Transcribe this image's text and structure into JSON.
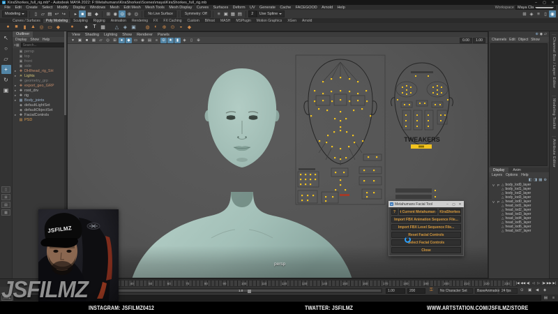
{
  "window": {
    "icon": "M",
    "title": "KiraShorkes_full_rig.mb* - Autodesk MAYA 2022: F:\\Metahumans\\KiraShorkes\\Scenes\\maya\\KiraShorkes_full_rig.mb",
    "min": "–",
    "max": "▢",
    "close": "✕"
  },
  "menubar": {
    "items": [
      "File",
      "Edit",
      "Create",
      "Select",
      "Modify",
      "Display",
      "Windows",
      "Mesh",
      "Edit Mesh",
      "Mesh Tools",
      "Mesh Display",
      "Curves",
      "Surfaces",
      "Deform",
      "UV",
      "Generate",
      "Cache",
      "FACEGOOD",
      "Arnold",
      "Help"
    ],
    "workspace_label": "Workspace",
    "workspace_value": "Maya Classic*"
  },
  "statusline": {
    "mode": "Modeling",
    "no_live_surface": "No Live Surface",
    "symmetry": "Symmetry: Off",
    "field": "2",
    "spline": "Use Spline",
    "group1": [
      {
        "n": "new-scene-icon",
        "g": "▯"
      },
      {
        "n": "open-scene-icon",
        "g": "▱"
      },
      {
        "n": "save-scene-icon",
        "g": "▤"
      },
      {
        "n": "undo-icon",
        "g": "↩"
      },
      {
        "n": "redo-icon",
        "g": "↪"
      }
    ],
    "group2": [
      {
        "n": "select-hierarchy-icon",
        "g": "▸"
      },
      {
        "n": "select-object-icon",
        "g": "■",
        "active": true
      },
      {
        "n": "select-component-icon",
        "g": "▦"
      },
      {
        "n": "select-mask-icon",
        "g": "◆"
      }
    ],
    "group3": [
      {
        "n": "snap-grid-icon",
        "g": "⊞"
      },
      {
        "n": "snap-curve-icon",
        "g": "◉"
      },
      {
        "n": "snap-point-icon",
        "g": "⊙",
        "active": true
      },
      {
        "n": "snap-plane-icon",
        "g": "⊕"
      },
      {
        "n": "make-live-icon",
        "g": "◎"
      }
    ],
    "group4": [
      {
        "n": "construction-history-icon",
        "g": "≡"
      },
      {
        "n": "render-view-icon",
        "g": "▣"
      },
      {
        "n": "render-current-frame-icon",
        "g": "▦"
      },
      {
        "n": "ipr-render-icon",
        "g": "▤"
      }
    ],
    "right_toggles": [
      {
        "n": "modeling-toolkit-toggle-icon",
        "g": "⊞"
      },
      {
        "n": "hypershade-toggle-icon",
        "g": "◈"
      },
      {
        "n": "outliner-toggle-icon",
        "g": "≡"
      },
      {
        "n": "panel-layout-icon",
        "g": "▯"
      },
      {
        "n": "tool-settings-toggle-icon",
        "g": "◉",
        "active": true
      }
    ]
  },
  "shelf": {
    "tabs": [
      {
        "label": "Curves / Surfaces"
      },
      {
        "label": "Poly Modeling",
        "active": true
      },
      {
        "label": "Sculpting"
      },
      {
        "label": "Rigging"
      },
      {
        "label": "Animation"
      },
      {
        "label": "Rendering"
      },
      {
        "label": "FX"
      },
      {
        "label": "FX Caching"
      },
      {
        "label": "Custom"
      },
      {
        "label": "Bifrost"
      },
      {
        "label": "MASH"
      },
      {
        "label": "MSPlugin"
      },
      {
        "label": "Motion Graphics"
      },
      {
        "label": "XGen"
      },
      {
        "label": "Arnold"
      }
    ],
    "icons": [
      {
        "n": "poly-sphere-icon",
        "g": "●",
        "c": "#d08a4a"
      },
      {
        "n": "poly-cube-icon",
        "g": "■",
        "c": "#d08a4a"
      },
      {
        "n": "poly-cylinder-icon",
        "g": "▮",
        "c": "#d08a4a"
      },
      {
        "n": "poly-cone-icon",
        "g": "▲",
        "c": "#d08a4a"
      },
      {
        "n": "poly-torus-icon",
        "g": "◎",
        "c": "#d08a4a"
      },
      {
        "n": "poly-plane-icon",
        "g": "▭",
        "c": "#d08a4a"
      },
      {
        "n": "poly-disc-icon",
        "g": "◆",
        "c": "#d08a4a"
      },
      {
        "n": "gap"
      },
      {
        "n": "platonic-solid-icon",
        "g": "●",
        "c": "#c87f42"
      },
      {
        "n": "gap"
      },
      {
        "n": "sweep-mesh-icon",
        "g": "★",
        "c": "#d8d8d8"
      },
      {
        "n": "type-tool-icon",
        "g": "T",
        "c": "#e0e0e0"
      },
      {
        "n": "svg-tool-icon",
        "g": "▦",
        "c": "#cfcfcf"
      },
      {
        "n": "gap"
      },
      {
        "n": "construction-plane-icon",
        "g": "△",
        "c": "#9db6c8"
      },
      {
        "n": "image-plane-icon",
        "g": "◈",
        "c": "#9db6c8"
      },
      {
        "n": "gpu-cache-icon",
        "g": "▣",
        "c": "#9db6c8"
      },
      {
        "n": "gap"
      },
      {
        "n": "boolean-union-icon",
        "g": "◍",
        "c": "#d08a4a"
      },
      {
        "n": "boolean-difference-icon",
        "g": "◐",
        "c": "#d08a4a"
      },
      {
        "n": "combine-icon",
        "g": "⊕",
        "c": "#d08a4a"
      },
      {
        "n": "separate-icon",
        "g": "⊙",
        "c": "#d08a4a"
      },
      {
        "n": "smooth-icon",
        "g": "◒",
        "c": "#d08a4a"
      },
      {
        "n": "bevel-icon",
        "g": "◆",
        "c": "#d08a4a"
      }
    ]
  },
  "toolbox": {
    "tools": [
      {
        "n": "select-tool-icon",
        "g": "↖"
      },
      {
        "n": "lasso-tool-icon",
        "g": "○"
      },
      {
        "n": "paint-select-tool-icon",
        "g": "▱"
      },
      {
        "n": "move-tool-icon",
        "g": "+",
        "active": true
      },
      {
        "n": "rotate-tool-icon",
        "g": "↻"
      },
      {
        "n": "scale-tool-icon",
        "g": "▣"
      }
    ],
    "layouts": [
      {
        "n": "layout-single-icon",
        "g": "▯"
      },
      {
        "n": "layout-four-icon",
        "g": "⊞"
      },
      {
        "n": "layout-split-icon",
        "g": "▤"
      },
      {
        "n": "layout-outliner-icon",
        "g": "▦"
      }
    ]
  },
  "outliner": {
    "tab": "Outliner",
    "menus": [
      "Display",
      "Show",
      "Help"
    ],
    "filter_icons": [
      {
        "n": "outliner-filter-icon",
        "g": "≡"
      },
      {
        "n": "outliner-sets-icon",
        "g": "▦"
      }
    ],
    "search_placeholder": "Search...",
    "items": [
      {
        "name": "persp",
        "icon": "▣",
        "c": "#8a8a8a",
        "dim": true
      },
      {
        "name": "top",
        "icon": "▣",
        "c": "#8a8a8a",
        "dim": true
      },
      {
        "name": "front",
        "icon": "▣",
        "c": "#8a8a8a",
        "dim": true
      },
      {
        "name": "side",
        "icon": "▣",
        "c": "#8a8a8a",
        "dim": true
      },
      {
        "name": "DHIhead_rig_SH",
        "exp": "▸",
        "icon": "✚",
        "c": "#c08a6a"
      },
      {
        "name": "Lights",
        "exp": "▸",
        "icon": "☀",
        "c": "#d8c878"
      },
      {
        "name": "geometry_grp",
        "icon": "✚",
        "c": "#8a8a8a",
        "dim": true
      },
      {
        "name": "export_geo_GRP",
        "exp": "▸",
        "icon": "✚",
        "c": "#c08a6a"
      },
      {
        "name": "root_drv",
        "exp": "▸",
        "icon": "✚",
        "c": "#b8b8b8"
      },
      {
        "name": "rig",
        "exp": "▸",
        "icon": "✚",
        "c": "#b8b8b8"
      },
      {
        "name": "Body_joints",
        "exp": "▸",
        "icon": "▦",
        "c": "#9ab0c8"
      },
      {
        "name": "defaultLightSet",
        "icon": "◈",
        "c": "#b0b0b0"
      },
      {
        "name": "defaultObjectSet",
        "icon": "◈",
        "c": "#b0b0b0"
      },
      {
        "name": "FacialControls",
        "exp": "▸",
        "icon": "✚",
        "c": "#b8b8b8"
      },
      {
        "name": "PSD",
        "icon": "▤",
        "c": "#d89a50"
      }
    ]
  },
  "viewport": {
    "menus": [
      "View",
      "Shading",
      "Lighting",
      "Show",
      "Renderer",
      "Panels"
    ],
    "toolbar_icons": [
      {
        "n": "vp-snap-icon",
        "g": "▾"
      },
      {
        "n": "vp-grid-icon",
        "g": "▣"
      },
      {
        "n": "vp-film-gate-icon",
        "g": "■"
      },
      {
        "n": "vp-resolution-gate-icon",
        "g": "▦"
      },
      {
        "n": "vp-gate-mask-icon",
        "g": "▱"
      },
      {
        "n": "vp-field-chart-icon",
        "g": "◎"
      },
      {
        "n": "vp-safe-action-icon",
        "g": "⊞"
      },
      {
        "n": "vp-wireframe-icon",
        "g": "●",
        "active": true
      },
      {
        "n": "vp-shaded-icon",
        "g": "◆",
        "active": true
      },
      {
        "n": "vp-textured-icon",
        "g": "▭"
      },
      {
        "n": "vp-lights-icon",
        "g": "◉"
      },
      {
        "n": "vp-shadows-icon",
        "g": "▤"
      },
      {
        "n": "vp-screenspace-ao-icon",
        "g": "≡"
      },
      {
        "n": "vp-motion-blur-icon",
        "g": "⊙",
        "active": true
      },
      {
        "n": "vp-multisample-icon",
        "g": "★",
        "active": true
      },
      {
        "n": "vp-depth-of-field-icon",
        "g": "▮",
        "active": true
      },
      {
        "n": "vp-isolate-select-icon",
        "g": "◈"
      },
      {
        "n": "vp-xray-icon",
        "g": "▯"
      },
      {
        "n": "vp-joints-xray-icon",
        "g": "⊕"
      }
    ],
    "exposure": "0.00",
    "gamma": "1.00",
    "camera_label": "persp",
    "board": {
      "tweakers": "TWEAKERS"
    }
  },
  "channelbox": {
    "top_icons": [
      {
        "n": "add-attribute-icon",
        "g": "⊕",
        "c": "#8fb6d8"
      },
      {
        "n": "show-manipulator-icon",
        "g": "◉",
        "c": "#c8c8c8"
      },
      {
        "n": "edit-attribute-icon",
        "g": "▱",
        "c": "#c8c8c8"
      }
    ],
    "menus": [
      "Channels",
      "Edit",
      "Object",
      "Show"
    ],
    "layer_tabs": [
      {
        "label": "Display",
        "active": true
      },
      {
        "label": "Anim"
      }
    ],
    "layer_menus": [
      "Layers",
      "Options",
      "Help"
    ],
    "layer_icons": [
      {
        "n": "layer-empty-icon",
        "g": "◧"
      },
      {
        "n": "layer-selected-icon",
        "g": "◨"
      },
      {
        "n": "layer-new-icon",
        "g": "▦"
      },
      {
        "n": "layer-add-icon",
        "g": "⊕"
      }
    ],
    "layers": [
      {
        "v": "V",
        "p": "P",
        "name": "body_lod0_layer"
      },
      {
        "v": "",
        "p": "",
        "name": "body_lod1_layer"
      },
      {
        "v": "",
        "p": "",
        "name": "body_lod2_layer"
      },
      {
        "v": "",
        "p": "",
        "name": "body_lod3_layer"
      },
      {
        "v": "V",
        "p": "P",
        "name": "head_lod0_layer"
      },
      {
        "v": "",
        "p": "",
        "name": "head_lod1_layer"
      },
      {
        "v": "",
        "p": "",
        "name": "head_lod2_layer"
      },
      {
        "v": "",
        "p": "",
        "name": "head_lod3_layer"
      },
      {
        "v": "",
        "p": "",
        "name": "head_lod4_layer"
      },
      {
        "v": "",
        "p": "",
        "name": "head_lod5_layer"
      },
      {
        "v": "",
        "p": "",
        "name": "head_lod6_layer"
      },
      {
        "v": "",
        "p": "",
        "name": "head_lod7_layer"
      }
    ],
    "side_tabs": [
      "Channel Box / Layer Editor",
      "Modeling Toolkit",
      "Attribute Editor"
    ]
  },
  "timeline": {
    "ticks": [
      "10",
      "20",
      "30",
      "40",
      "50",
      "60",
      "70",
      "80",
      "90",
      "100",
      "110",
      "120",
      "130",
      "140",
      "150",
      "160",
      "170",
      "180",
      "190",
      "200",
      "210",
      "220",
      "230"
    ],
    "playback": [
      {
        "n": "go-to-start-button",
        "g": "|◀"
      },
      {
        "n": "step-back-frame-button",
        "g": "◀◀"
      },
      {
        "n": "step-back-key-button",
        "g": "◀|"
      },
      {
        "n": "play-backwards-button",
        "g": "◁"
      },
      {
        "n": "play-forwards-button",
        "g": "▷"
      },
      {
        "n": "step-fwd-key-button",
        "g": "|▶"
      },
      {
        "n": "step-fwd-frame-button",
        "g": "▶▶"
      },
      {
        "n": "go-to-end-button",
        "g": "▶|"
      }
    ]
  },
  "range": {
    "bar_value": "1.0",
    "playback_end": "1.00",
    "anim_end": "200",
    "character_set": "No Character Set",
    "anim_layer": "BaseAnimation",
    "fps": "24 fps",
    "right_icons": [
      {
        "n": "auto-key-icon",
        "g": "⊙"
      },
      {
        "n": "playback-options-icon",
        "g": "▣",
        "active": true
      },
      {
        "n": "mute-audio-icon",
        "g": "◀"
      },
      {
        "n": "anim-prefs-icon",
        "g": "◈"
      }
    ],
    "key_icon": "⚿"
  },
  "command": {
    "mel": "MEL",
    "right_icons": [
      {
        "n": "script-editor-icon",
        "g": "▤"
      },
      {
        "n": "command-history-icon",
        "g": "≡"
      }
    ]
  },
  "banner": {
    "instagram": "INSTAGRAM: JSFILMZ0412",
    "twitter": "TWATTER: JSFILMZ",
    "website": "WWW.ARTSTATION.COM/JSFILMZ/STORE"
  },
  "webcam": {
    "cap_text": "JSFILMZ"
  },
  "watermark": "JSFILMZ",
  "maya_badge": "M",
  "dialog": {
    "icon": "M",
    "title": "Metahumans Facial Tool",
    "min": "–",
    "max": "▢",
    "x": "✕",
    "help": "?",
    "set_current": "Set Current Metahuman -->",
    "metahuman_name": "KiraShorkes",
    "import_anim": "Import FBX Animation Sequence File...",
    "import_level": "Import FBX Level Sequence File...",
    "reset": "Reset Facial Controls",
    "select": "Select Facial Controls",
    "close": "Close"
  }
}
